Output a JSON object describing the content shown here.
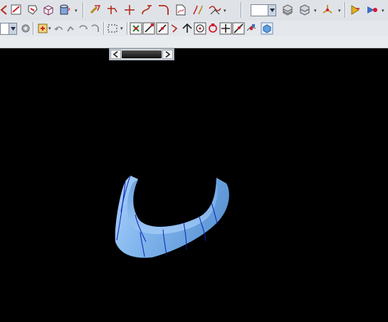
{
  "toolbar_row1": {
    "icons": [
      "curve-tool-icon",
      "sketch-icon",
      "datum-icon",
      "box-icon",
      "cylinder-icon",
      "offset-curve-icon",
      "trim-curve-icon",
      "extend-curve-icon",
      "corner-icon",
      "curve-on-surface-icon",
      "mirror-curve-icon",
      "wave-curve-icon",
      "view-style-dropdown",
      "layer-icon",
      "layer-settings-icon",
      "orient-view-icon",
      "play-icon"
    ]
  },
  "toolbar_row2": {
    "icons": [
      "selection-filter-dropdown",
      "snap-settings-icon",
      "component-icon",
      "undo-icon",
      "redo-icon",
      "repeat-icon",
      "select-box-icon",
      "snap-all-icon",
      "snap-endpoint-icon",
      "snap-midpoint-icon",
      "snap-control-icon",
      "snap-intersection-icon",
      "snap-arc-center-icon",
      "snap-quadrant-icon",
      "snap-existing-point-icon",
      "snap-point-on-curve-icon",
      "snap-point-on-surface-icon",
      "view-cube-icon"
    ]
  },
  "scrollbar": {
    "left_label": "<",
    "right_label": ">"
  },
  "viewport": {
    "background": "#000000",
    "model_color": "#7fb4ec",
    "isoline_color": "#0a1fb8",
    "model_name": "curved-surface-body"
  }
}
